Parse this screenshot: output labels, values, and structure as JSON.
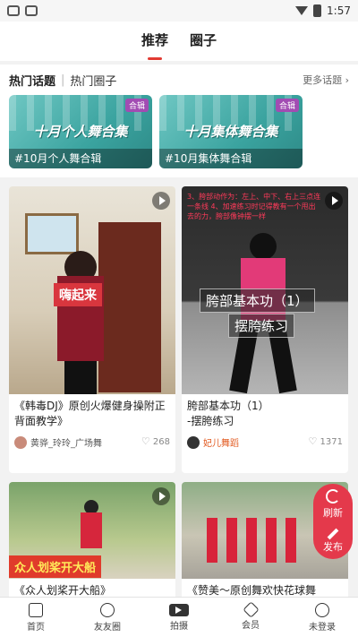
{
  "status": {
    "time": "1:57"
  },
  "tabs": [
    {
      "label": "推荐",
      "active": true
    },
    {
      "label": "圈子",
      "active": false
    }
  ],
  "topics": {
    "hot_topics_label": "热门话题",
    "hot_circles_label": "热门圈子",
    "more_label": "更多话题",
    "cards": [
      {
        "big_title": "十月个人舞合集",
        "tag": "合辑",
        "caption": "#10月个人舞合辑"
      },
      {
        "big_title": "十月集体舞合集",
        "tag": "合辑",
        "caption": "#10月集体舞合辑"
      }
    ]
  },
  "feed": [
    {
      "overlay": "嗨起来",
      "title": "《韩毒DJ》原创火爆健身操附正背面教学》",
      "author": "黄骅_玲玲_广场舞",
      "likes": "268"
    },
    {
      "top_text": "3、胯部动作为：左上、中下、右上三点连一条线 4、加速练习时记得教有一个甩出去的力，胯部像钟摆一样",
      "overlay_line1": "胯部基本功（1）",
      "overlay_line2": "摆胯练习",
      "title": "胯部基本功（1）\n-摆胯练习",
      "author": "妃儿舞蹈",
      "likes": "1371"
    },
    {
      "overlay": "众人划桨开大船",
      "title": "《众人划桨开大船》"
    },
    {
      "title": "《赞美～原创舞欢快花球舞"
    }
  ],
  "float": {
    "refresh": "刷新",
    "publish": "发布"
  },
  "nav": [
    {
      "label": "首页"
    },
    {
      "label": "友友圈"
    },
    {
      "label": "拍摄"
    },
    {
      "label": "会员"
    },
    {
      "label": "未登录"
    }
  ],
  "colors": {
    "accent": "#e23b33",
    "float_bg": "#e4394b",
    "topic_teal": "#3aa39f"
  }
}
